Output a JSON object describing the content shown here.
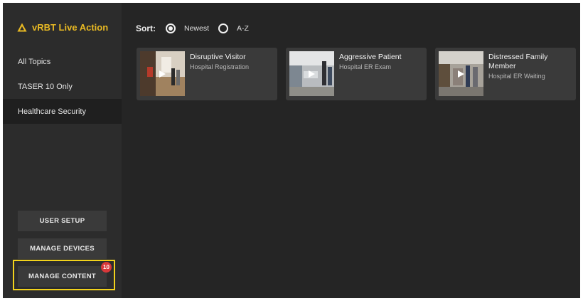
{
  "app": {
    "title": "vRBT Live Action",
    "accent": "#e8b923"
  },
  "sidebar": {
    "items": [
      {
        "label": "All Topics"
      },
      {
        "label": "TASER 10 Only"
      },
      {
        "label": "Healthcare Security",
        "selected": true
      }
    ],
    "buttons": {
      "user_setup": "USER SETUP",
      "manage_devices": "MANAGE DEVICES",
      "manage_content": "MANAGE CONTENT",
      "manage_content_badge": "10"
    },
    "highlight_color": "#f2d21c"
  },
  "sort": {
    "label": "Sort:",
    "options": [
      {
        "label": "Newest",
        "checked": true
      },
      {
        "label": "A-Z",
        "checked": false
      }
    ]
  },
  "cards": [
    {
      "title": "Disruptive Visitor",
      "subtitle": "Hospital Registration",
      "icon": "play-icon"
    },
    {
      "title": "Aggressive Patient",
      "subtitle": "Hospital ER Exam",
      "icon": "play-icon"
    },
    {
      "title": "Distressed Family Member",
      "subtitle": "Hospital ER Waiting",
      "icon": "play-icon"
    }
  ]
}
